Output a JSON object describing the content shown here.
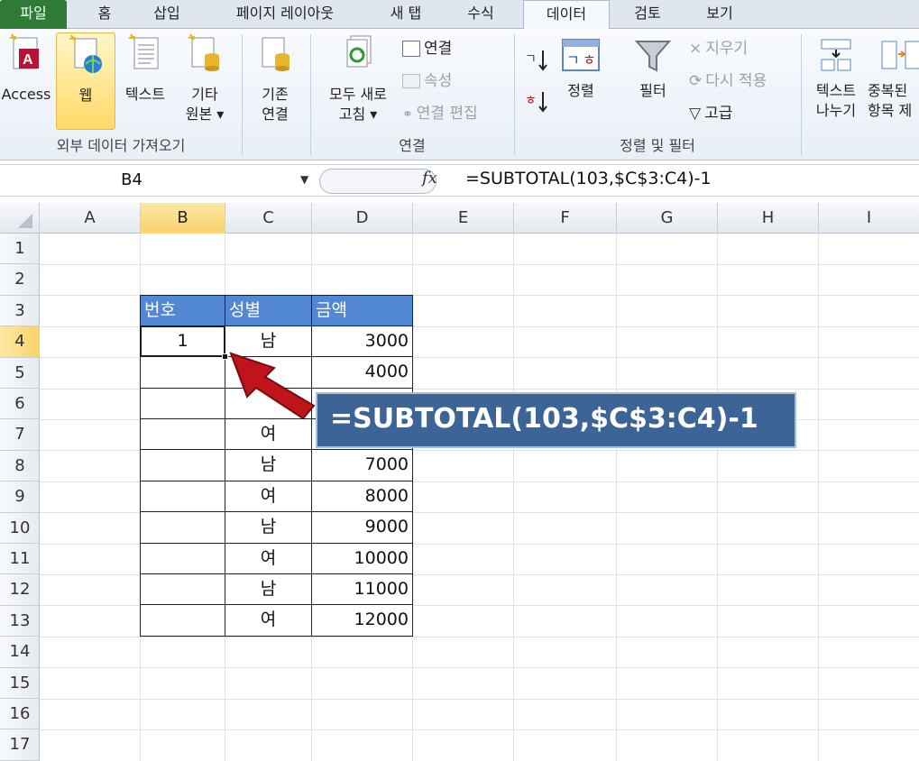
{
  "tabs": [
    {
      "label": "파일",
      "active": false,
      "file": true
    },
    {
      "label": "홈"
    },
    {
      "label": "삽입"
    },
    {
      "label": "페이지 레이아웃"
    },
    {
      "label": "새 탭"
    },
    {
      "label": "수식"
    },
    {
      "label": "데이터",
      "active": true
    },
    {
      "label": "검토"
    },
    {
      "label": "보기"
    }
  ],
  "ribbon": {
    "ext": {
      "access": "Access",
      "web": "웹",
      "text": "텍스트",
      "other_1": "기타",
      "other_2": "원본 ▾",
      "group_label": "외부 데이터 가져오기"
    },
    "existing_1": "기존",
    "existing_2": "연결",
    "conn": {
      "refresh_1": "모두 새로",
      "refresh_2": "고침 ▾",
      "connections": "연결",
      "properties": "속성",
      "edit_links": "연결 편집",
      "group_label": "연결"
    },
    "sort": {
      "sort": "정렬",
      "filter": "필터",
      "clear": "지우기",
      "reapply": "다시 적용",
      "advanced": "고급",
      "group_label": "정렬 및 필터"
    },
    "tools": {
      "text_to_col_1": "텍스트",
      "text_to_col_2": "나누기",
      "dup_1": "중복된",
      "dup_2": "항목 제"
    }
  },
  "formula_bar": {
    "name_box": "B4",
    "fx": "fx",
    "formula": "=SUBTOTAL(103,$C$3:C4)-1"
  },
  "columns": [
    "A",
    "B",
    "C",
    "D",
    "E",
    "F",
    "G",
    "H",
    "I"
  ],
  "rows": [
    "1",
    "2",
    "3",
    "4",
    "5",
    "6",
    "7",
    "8",
    "9",
    "10",
    "11",
    "12",
    "13",
    "14",
    "15",
    "16",
    "17"
  ],
  "table": {
    "headers": [
      "번호",
      "성별",
      "금액"
    ],
    "rows": [
      {
        "num": "1",
        "gender": "남",
        "amount": "3000"
      },
      {
        "num": "",
        "gender": "",
        "amount": "4000"
      },
      {
        "num": "",
        "gender": "",
        "amount": ""
      },
      {
        "num": "",
        "gender": "여",
        "amount": ""
      },
      {
        "num": "",
        "gender": "남",
        "amount": "7000"
      },
      {
        "num": "",
        "gender": "여",
        "amount": "8000"
      },
      {
        "num": "",
        "gender": "남",
        "amount": "9000"
      },
      {
        "num": "",
        "gender": "여",
        "amount": "10000"
      },
      {
        "num": "",
        "gender": "남",
        "amount": "11000"
      },
      {
        "num": "",
        "gender": "여",
        "amount": "12000"
      }
    ]
  },
  "callout": {
    "text": "=SUBTOTAL(103,$C$3:C4)-1"
  },
  "colors": {
    "accent": "#5287d3",
    "callout": "#3c6497",
    "arrow": "#c0141c",
    "file_tab": "#2d7b35"
  }
}
